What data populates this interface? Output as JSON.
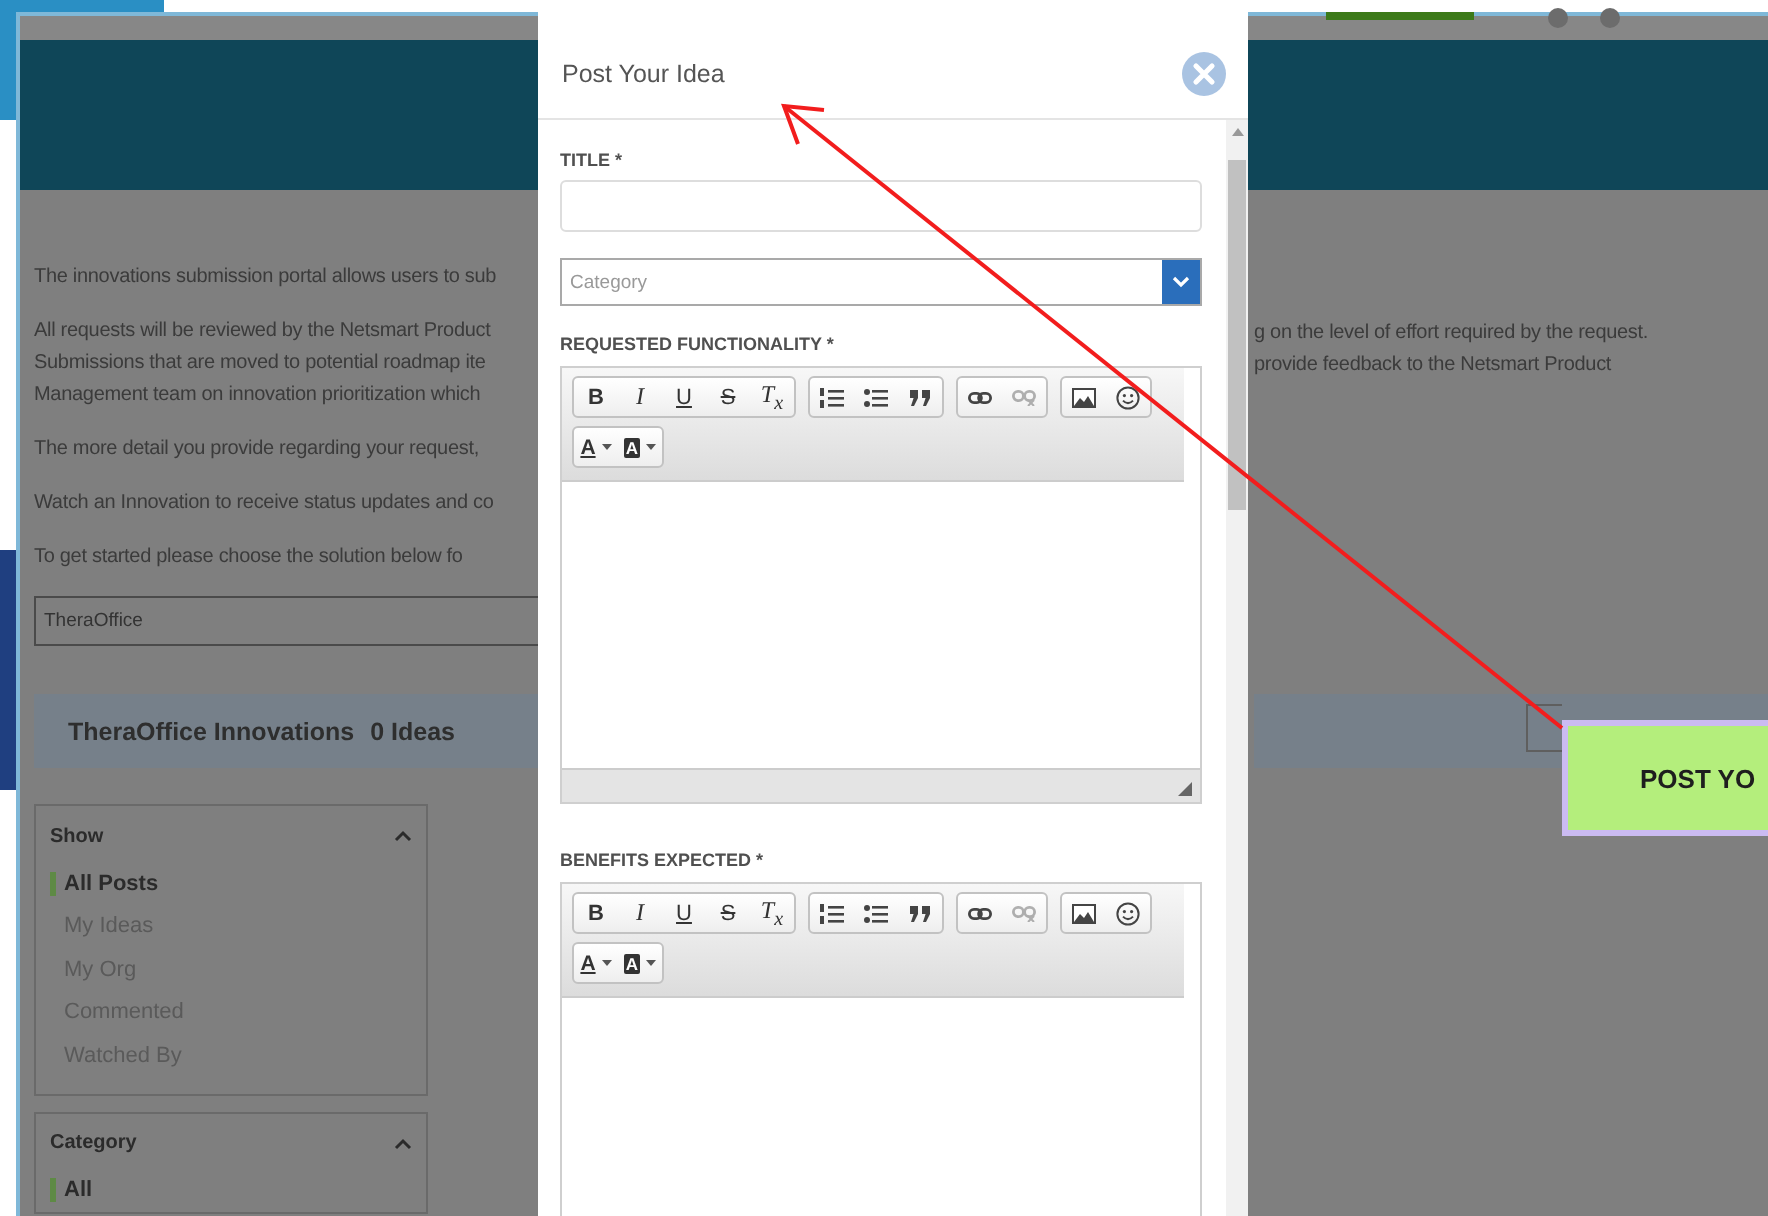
{
  "page": {
    "intro": [
      [
        "The innovations submission portal allows users to sub"
      ],
      [
        "All requests will be reviewed by the Netsmart Product",
        "Submissions that are moved to potential roadmap ite",
        "Management team on innovation prioritization which"
      ],
      [
        "The more detail you provide regarding your request,"
      ],
      [
        "Watch an Innovation to receive status updates and co"
      ],
      [
        "To get started please choose the solution below fo"
      ]
    ],
    "intro_right": [
      "g on the level of effort required by the request.",
      "provide feedback to the Netsmart Product"
    ],
    "product_select": {
      "value": "TheraOffice"
    },
    "innovations_bar": {
      "title": "TheraOffice Innovations",
      "count": "0 Ideas"
    },
    "filters": [
      {
        "title": "Show",
        "expanded": true,
        "items": [
          {
            "label": "All Posts",
            "selected": true
          },
          {
            "label": "My Ideas",
            "selected": false
          },
          {
            "label": "My Org",
            "selected": false
          },
          {
            "label": "Commented",
            "selected": false
          },
          {
            "label": "Watched By",
            "selected": false
          }
        ]
      },
      {
        "title": "Category",
        "expanded": true,
        "items": [
          {
            "label": "All",
            "selected": true
          }
        ]
      }
    ],
    "post_button": {
      "label": "POST YO"
    }
  },
  "modal": {
    "title": "Post Your Idea",
    "fields": [
      {
        "kind": "text",
        "label": "TITLE *"
      },
      {
        "kind": "select",
        "placeholder": "Category"
      },
      {
        "kind": "editor",
        "label": "REQUESTED FUNCTIONALITY *",
        "resizable": true
      },
      {
        "kind": "editor",
        "label": "BENEFITS EXPECTED *"
      }
    ],
    "toolbars": [
      [
        [
          {
            "kind": "bold",
            "label": "B",
            "disabled": false
          },
          {
            "kind": "italic",
            "label": "I",
            "disabled": false
          },
          {
            "kind": "underline",
            "label": "U",
            "disabled": false
          },
          {
            "kind": "strike",
            "label": "S",
            "disabled": false
          },
          {
            "kind": "clear-format",
            "label": "T$_{x}$",
            "disabled": false
          }
        ],
        [
          {
            "kind": "numbered-list",
            "disabled": false
          },
          {
            "kind": "bullet-list",
            "disabled": false
          },
          {
            "kind": "quote",
            "disabled": false
          }
        ],
        [
          {
            "kind": "link",
            "disabled": false
          },
          {
            "kind": "unlink",
            "disabled": true
          }
        ],
        [
          {
            "kind": "image",
            "disabled": false
          },
          {
            "kind": "emoji",
            "disabled": false
          }
        ],
        [
          {
            "kind": "text-color",
            "label": "A",
            "disabled": false
          },
          {
            "kind": "background-color",
            "label": "A",
            "disabled": false
          }
        ]
      ],
      [
        [
          {
            "kind": "bold",
            "label": "B",
            "disabled": false
          },
          {
            "kind": "italic",
            "label": "I",
            "disabled": false
          },
          {
            "kind": "underline",
            "label": "U",
            "disabled": false
          },
          {
            "kind": "strike",
            "label": "S",
            "disabled": false
          },
          {
            "kind": "clear-format",
            "label": "T$_{x}$",
            "disabled": false
          }
        ],
        [
          {
            "kind": "numbered-list",
            "disabled": false
          },
          {
            "kind": "bullet-list",
            "disabled": false
          },
          {
            "kind": "quote",
            "disabled": false
          }
        ],
        [
          {
            "kind": "link",
            "disabled": false
          },
          {
            "kind": "unlink",
            "disabled": true
          }
        ],
        [
          {
            "kind": "image",
            "disabled": false
          },
          {
            "kind": "emoji",
            "disabled": false
          }
        ],
        [
          {
            "kind": "text-color",
            "label": "A",
            "disabled": false
          },
          {
            "kind": "background-color",
            "label": "A",
            "disabled": false
          }
        ]
      ]
    ]
  }
}
